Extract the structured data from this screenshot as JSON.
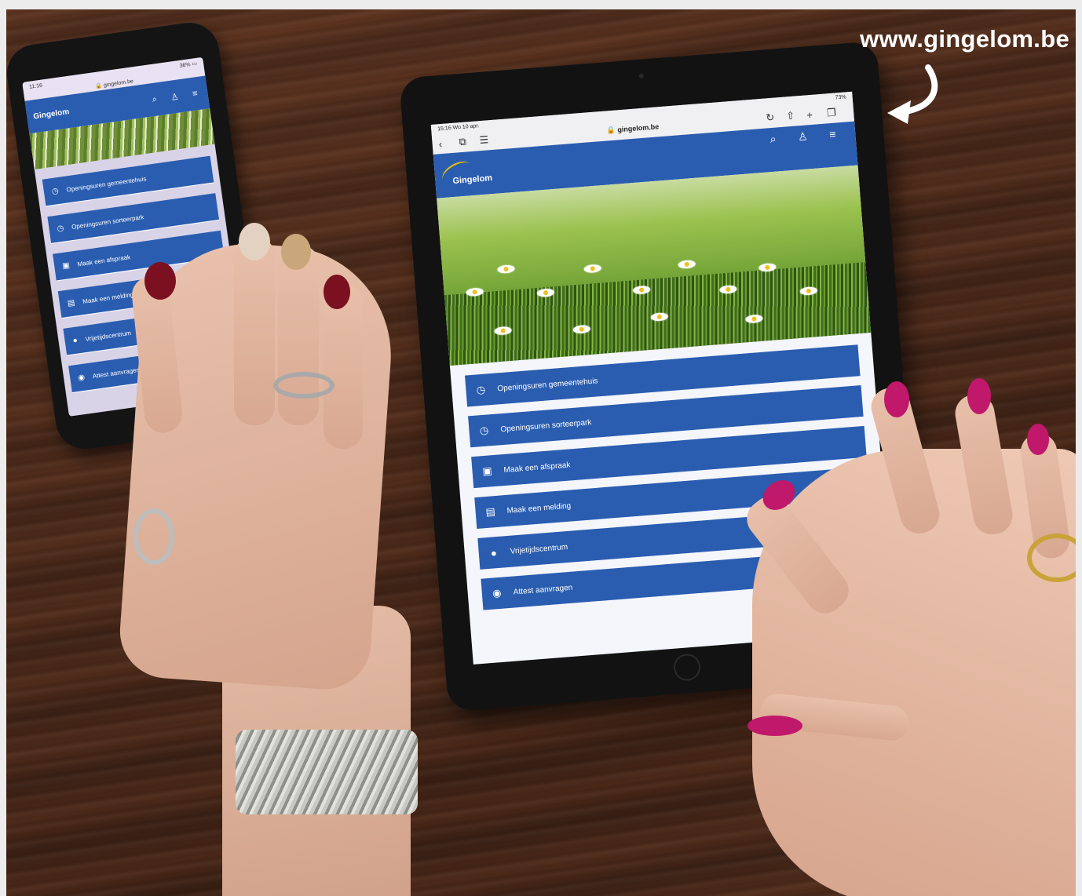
{
  "overlay": {
    "url_label": "www.gingelom.be"
  },
  "phone": {
    "status_time": "11:16",
    "status_right": "36% ▭",
    "address": "gingelom.be",
    "logo_text": "Gingelom",
    "menu_items": [
      {
        "icon": "clock-icon",
        "glyph": "◷",
        "label": "Openingsuren gemeentehuis"
      },
      {
        "icon": "clock-icon",
        "glyph": "◷",
        "label": "Openingsuren sorteerpark"
      },
      {
        "icon": "calendar-icon",
        "glyph": "▣",
        "label": "Maak een afspraak"
      },
      {
        "icon": "message-icon",
        "glyph": "▤",
        "label": "Maak een melding"
      },
      {
        "icon": "location-pin-icon",
        "glyph": "●",
        "label": "Vrijetijdscentrum"
      },
      {
        "icon": "person-icon",
        "glyph": "◉",
        "label": "Attest aanvragen"
      }
    ]
  },
  "tablet": {
    "status_left": "15:16  Wo 10 apr.",
    "status_right": "73%",
    "address": "gingelom.be",
    "logo_text": "Gingelom",
    "menu_items": [
      {
        "icon": "clock-icon",
        "glyph": "◷",
        "label": "Openingsuren gemeentehuis"
      },
      {
        "icon": "clock-icon",
        "glyph": "◷",
        "label": "Openingsuren sorteerpark"
      },
      {
        "icon": "calendar-icon",
        "glyph": "▣",
        "label": "Maak een afspraak"
      },
      {
        "icon": "message-icon",
        "glyph": "▤",
        "label": "Maak een melding"
      },
      {
        "icon": "location-pin-icon",
        "glyph": "●",
        "label": "Vrijetijdscentrum"
      },
      {
        "icon": "person-icon",
        "glyph": "◉",
        "label": "Attest aanvragen"
      }
    ]
  },
  "colors": {
    "brand_blue": "#2a5db0",
    "logo_yellow": "#f2c200",
    "table_wood": "#4a2a1b",
    "nail_dark_red": "#7a1020",
    "nail_magenta": "#c0186a"
  }
}
